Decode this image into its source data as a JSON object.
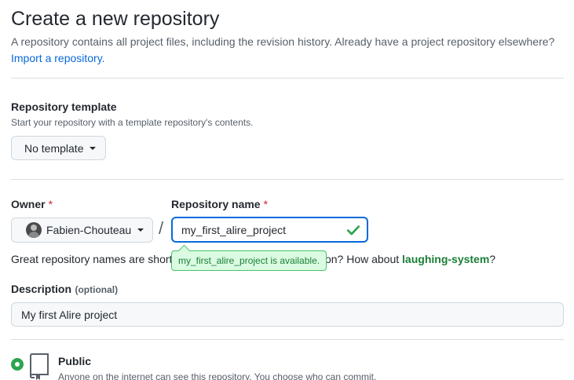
{
  "header": {
    "title": "Create a new repository",
    "description": "A repository contains all project files, including the revision history. Already have a project repository elsewhere?",
    "import_link": "Import a repository."
  },
  "template": {
    "label": "Repository template",
    "note": "Start your repository with a template repository's contents.",
    "button_label": "No template"
  },
  "owner": {
    "label": "Owner",
    "required_mark": "*",
    "value": "Fabien-Chouteau"
  },
  "separator": "/",
  "repo_name": {
    "label": "Repository name",
    "required_mark": "*",
    "value": "my_first_alire_project",
    "availability": "my_first_alire_project is available.",
    "valid_color": "#1a7f37"
  },
  "hint": {
    "prefix": "Great repository names are short and memorable. Need inspiration? How about ",
    "suggestion": "laughing-system",
    "suffix": "?"
  },
  "description": {
    "label": "Description",
    "optional": "(optional)",
    "value": "My first Alire project"
  },
  "visibility": {
    "selected": "Public",
    "public_label": "Public",
    "public_desc": "Anyone on the internet can see this repository. You choose who can commit.",
    "accent_color": "#2da44e"
  },
  "icons": [
    "caret-down-icon",
    "avatar",
    "check-icon",
    "repo-icon"
  ]
}
